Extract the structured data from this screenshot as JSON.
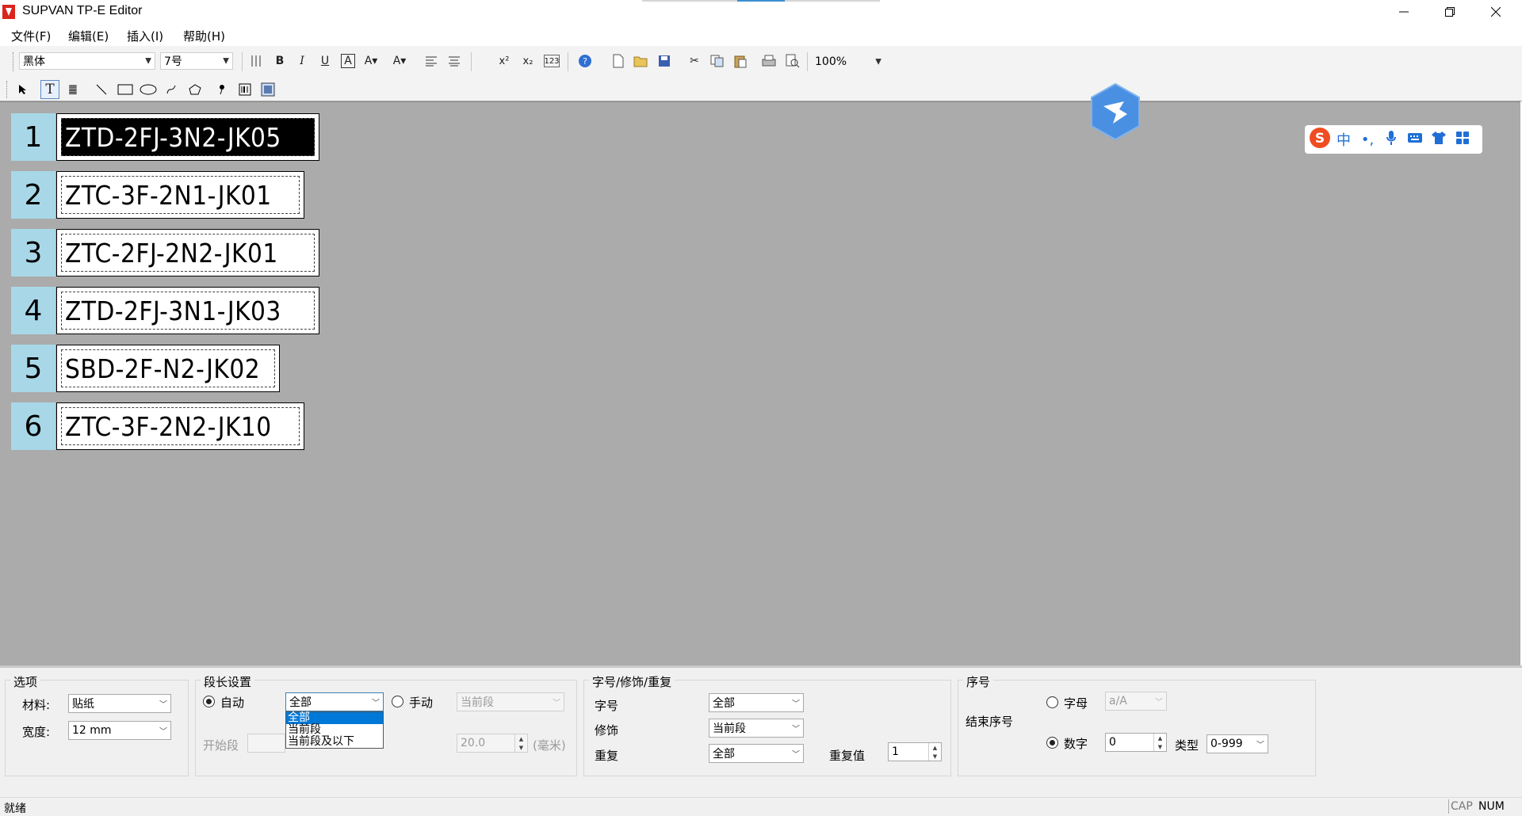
{
  "window": {
    "title": "SUPVAN TP-E Editor",
    "minimize_icon": "minimize-icon",
    "restore_icon": "restore-icon",
    "close_icon": "close-icon"
  },
  "menu": {
    "items": [
      "文件(F)",
      "编辑(E)",
      "插入(I)",
      "帮助(H)"
    ]
  },
  "toolbar": {
    "font_name": "黑体",
    "font_size": "7号",
    "zoom": "100%",
    "counter_icon_text": "123"
  },
  "labels": [
    {
      "num": "1",
      "text": "ZTD-2FJ-3N2-JK05",
      "selected": true
    },
    {
      "num": "2",
      "text": "ZTC-3F-2N1-JK01",
      "selected": false
    },
    {
      "num": "3",
      "text": "ZTC-2FJ-2N2-JK01",
      "selected": false
    },
    {
      "num": "4",
      "text": "ZTD-2FJ-3N1-JK03",
      "selected": false
    },
    {
      "num": "5",
      "text": "SBD-2F-N2-JK02",
      "selected": false
    },
    {
      "num": "6",
      "text": "ZTC-3F-2N2-JK10",
      "selected": false
    }
  ],
  "options": {
    "title": "选项",
    "material_label": "材料:",
    "material_value": "贴纸",
    "width_label": "宽度:",
    "width_value": "12 mm"
  },
  "segment": {
    "title": "段长设置",
    "auto_label": "自动",
    "auto_checked": true,
    "auto_select_value": "全部",
    "dropdown_options": [
      "全部",
      "当前段",
      "当前段及以下"
    ],
    "dropdown_highlight": 0,
    "manual_label": "手动",
    "manual_select_value": "当前段",
    "start_label": "开始段",
    "length_value": "20.0",
    "unit_label": "(毫米)"
  },
  "font_group": {
    "title": "字号/修饰/重复",
    "size_label": "字号",
    "size_value": "全部",
    "style_label": "修饰",
    "style_value": "当前段",
    "repeat_label": "重复",
    "repeat_value": "全部",
    "repeat_count_label": "重复值",
    "repeat_count_value": "1"
  },
  "serial": {
    "title": "序号",
    "end_label": "结束序号",
    "letter_label": "字母",
    "letter_select": "a/A",
    "number_label": "数字",
    "number_checked": true,
    "number_value": "0",
    "type_label": "类型",
    "type_value": "0-999"
  },
  "status": {
    "text": "就绪",
    "cap": "CAP",
    "num": "NUM"
  },
  "ime": {
    "icons": [
      "sogou-logo-icon",
      "chinese-mode-icon",
      "punctuation-icon",
      "microphone-icon",
      "keyboard-icon",
      "skin-icon",
      "apps-grid-icon"
    ],
    "mode_text": "中",
    "punct_text": "•,"
  },
  "colors": {
    "canvas_bg": "#ababab",
    "label_number_bg": "#a8d8e8",
    "selection_blue": "#0078d7",
    "sogou_red": "#f04c22",
    "ime_blue": "#1f6fd6",
    "hex_blue": "#4a90e2"
  }
}
